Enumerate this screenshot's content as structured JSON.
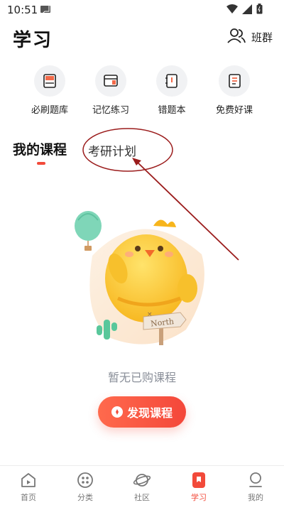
{
  "status_bar": {
    "time": "10:51"
  },
  "header": {
    "title": "学习",
    "group_label": "班群"
  },
  "quick_actions": [
    {
      "label": "必刷题库",
      "icon": "question-bank-icon"
    },
    {
      "label": "记忆练习",
      "icon": "memory-practice-icon"
    },
    {
      "label": "错题本",
      "icon": "mistake-book-icon"
    },
    {
      "label": "免费好课",
      "icon": "free-course-icon"
    }
  ],
  "tabs": [
    {
      "label": "我的课程",
      "active": true
    },
    {
      "label": "考研计划",
      "active": false
    }
  ],
  "empty_state": {
    "sign_text": "North",
    "message": "暂无已购课程",
    "button_label": "发现课程"
  },
  "bottom_nav": [
    {
      "label": "首页",
      "icon": "home-icon",
      "active": false
    },
    {
      "label": "分类",
      "icon": "category-icon",
      "active": false
    },
    {
      "label": "社区",
      "icon": "community-icon",
      "active": false
    },
    {
      "label": "学习",
      "icon": "study-icon",
      "active": true
    },
    {
      "label": "我的",
      "icon": "profile-icon",
      "active": false
    }
  ],
  "colors": {
    "accent": "#f24a3a",
    "annotation": "#9b1c1c",
    "muted_text": "#8a8f99"
  }
}
